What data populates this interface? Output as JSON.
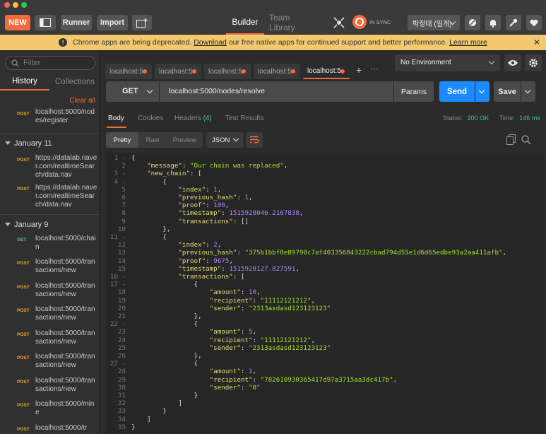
{
  "topbar": {
    "new_label": "NEW",
    "runner_label": "Runner",
    "import_label": "Import",
    "builder_tab": "Builder",
    "team_library_tab": "Team Library",
    "sync_label": "IN SYNC",
    "user_label": "박정태 (일개)"
  },
  "banner": {
    "text_before": "Chrome apps are being deprecated.",
    "download_link": "Download",
    "text_middle": "our free native apps for continued support and better performance.",
    "learn_more": "Learn more"
  },
  "sidebar": {
    "filter_placeholder": "Filter",
    "tab_history": "History",
    "tab_collections": "Collections",
    "clear_all": "Clear all",
    "top_item": {
      "method": "POST",
      "url": "localhost:5000/nodes/register"
    },
    "groups": [
      {
        "date": "January 11",
        "items": [
          {
            "method": "POST",
            "url": "https://datalab.naver.com/realtimeSearch/data.nav"
          },
          {
            "method": "POST",
            "url": "https://datalab.naver.com/realtimeSearch/data.nav"
          }
        ]
      },
      {
        "date": "January 9",
        "items": [
          {
            "method": "GET",
            "url": "localhost:5000/chain"
          },
          {
            "method": "POST",
            "url": "localhost:5000/transactions/new"
          },
          {
            "method": "POST",
            "url": "localhost:5000/transactions/new"
          },
          {
            "method": "POST",
            "url": "localhost:5000/transactions/new"
          },
          {
            "method": "POST",
            "url": "localhost:5000/transactions/new"
          },
          {
            "method": "POST",
            "url": "localhost:5000/transactions/new"
          },
          {
            "method": "POST",
            "url": "localhost:5000/transactions/new"
          },
          {
            "method": "POST",
            "url": "localhost:5000/mine"
          },
          {
            "method": "POST",
            "url": "localhost:5000/tr"
          }
        ]
      }
    ]
  },
  "tabs": [
    "localhost:5",
    "localhost:5",
    "localhost:5",
    "localhost:5",
    "localhost:5"
  ],
  "environment": "No Environment",
  "request": {
    "method": "GET",
    "url": "localhost:5000/nodes/resolve",
    "params_label": "Params",
    "send_label": "Send",
    "save_label": "Save"
  },
  "response_tabs": {
    "body": "Body",
    "cookies": "Cookies",
    "headers": "Headers",
    "headers_count": "(4)",
    "test_results": "Test Results",
    "status_label": "Status:",
    "status_value": "200 OK",
    "time_label": "Time:",
    "time_value": "146 ms"
  },
  "view_options": {
    "pretty": "Pretty",
    "raw": "Raw",
    "preview": "Preview",
    "format": "JSON"
  },
  "code_lines": [
    [
      [
        "p",
        "{"
      ]
    ],
    [
      [
        "p",
        "    "
      ],
      [
        "k",
        "\"message\""
      ],
      [
        "p",
        ": "
      ],
      [
        "s",
        "\"Our chain was replaced\""
      ],
      [
        "p",
        ","
      ]
    ],
    [
      [
        "p",
        "    "
      ],
      [
        "k",
        "\"new_chain\""
      ],
      [
        "p",
        ": ["
      ]
    ],
    [
      [
        "p",
        "        {"
      ]
    ],
    [
      [
        "p",
        "            "
      ],
      [
        "k",
        "\"index\""
      ],
      [
        "p",
        ": "
      ],
      [
        "n",
        "1"
      ],
      [
        "p",
        ","
      ]
    ],
    [
      [
        "p",
        "            "
      ],
      [
        "k",
        "\"previous_hash\""
      ],
      [
        "p",
        ": "
      ],
      [
        "n",
        "1"
      ],
      [
        "p",
        ","
      ]
    ],
    [
      [
        "p",
        "            "
      ],
      [
        "k",
        "\"proof\""
      ],
      [
        "p",
        ": "
      ],
      [
        "n",
        "100"
      ],
      [
        "p",
        ","
      ]
    ],
    [
      [
        "p",
        "            "
      ],
      [
        "k",
        "\"timestamp\""
      ],
      [
        "p",
        ": "
      ],
      [
        "n",
        "1515928046.2167838"
      ],
      [
        "p",
        ","
      ]
    ],
    [
      [
        "p",
        "            "
      ],
      [
        "k",
        "\"transactions\""
      ],
      [
        "p",
        ": []"
      ]
    ],
    [
      [
        "p",
        "        },"
      ]
    ],
    [
      [
        "p",
        "        {"
      ]
    ],
    [
      [
        "p",
        "            "
      ],
      [
        "k",
        "\"index\""
      ],
      [
        "p",
        ": "
      ],
      [
        "n",
        "2"
      ],
      [
        "p",
        ","
      ]
    ],
    [
      [
        "p",
        "            "
      ],
      [
        "k",
        "\"previous_hash\""
      ],
      [
        "p",
        ": "
      ],
      [
        "s",
        "\"375b1bbf0e89790c7af403356843222cbad794d55e1d6d65edbe93a2aa411afb\""
      ],
      [
        "p",
        ","
      ]
    ],
    [
      [
        "p",
        "            "
      ],
      [
        "k",
        "\"proof\""
      ],
      [
        "p",
        ": "
      ],
      [
        "n",
        "9675"
      ],
      [
        "p",
        ","
      ]
    ],
    [
      [
        "p",
        "            "
      ],
      [
        "k",
        "\"timestamp\""
      ],
      [
        "p",
        ": "
      ],
      [
        "n",
        "1515928127.827591"
      ],
      [
        "p",
        ","
      ]
    ],
    [
      [
        "p",
        "            "
      ],
      [
        "k",
        "\"transactions\""
      ],
      [
        "p",
        ": ["
      ]
    ],
    [
      [
        "p",
        "                {"
      ]
    ],
    [
      [
        "p",
        "                    "
      ],
      [
        "k",
        "\"amount\""
      ],
      [
        "p",
        ": "
      ],
      [
        "n",
        "10"
      ],
      [
        "p",
        ","
      ]
    ],
    [
      [
        "p",
        "                    "
      ],
      [
        "k",
        "\"recipient\""
      ],
      [
        "p",
        ": "
      ],
      [
        "s",
        "\"11112121212\""
      ],
      [
        "p",
        ","
      ]
    ],
    [
      [
        "p",
        "                    "
      ],
      [
        "k",
        "\"sender\""
      ],
      [
        "p",
        ": "
      ],
      [
        "s",
        "\"2313asdasd123123123\""
      ]
    ],
    [
      [
        "p",
        "                },"
      ]
    ],
    [
      [
        "p",
        "                {"
      ]
    ],
    [
      [
        "p",
        "                    "
      ],
      [
        "k",
        "\"amount\""
      ],
      [
        "p",
        ": "
      ],
      [
        "n",
        "5"
      ],
      [
        "p",
        ","
      ]
    ],
    [
      [
        "p",
        "                    "
      ],
      [
        "k",
        "\"recipient\""
      ],
      [
        "p",
        ": "
      ],
      [
        "s",
        "\"11112121212\""
      ],
      [
        "p",
        ","
      ]
    ],
    [
      [
        "p",
        "                    "
      ],
      [
        "k",
        "\"sender\""
      ],
      [
        "p",
        ": "
      ],
      [
        "s",
        "\"2313asdasd123123123\""
      ]
    ],
    [
      [
        "p",
        "                },"
      ]
    ],
    [
      [
        "p",
        "                {"
      ]
    ],
    [
      [
        "p",
        "                    "
      ],
      [
        "k",
        "\"amount\""
      ],
      [
        "p",
        ": "
      ],
      [
        "n",
        "1"
      ],
      [
        "p",
        ","
      ]
    ],
    [
      [
        "p",
        "                    "
      ],
      [
        "k",
        "\"recipient\""
      ],
      [
        "p",
        ": "
      ],
      [
        "s",
        "\"782610930365417d97a3715aa3dc417b\""
      ],
      [
        "p",
        ","
      ]
    ],
    [
      [
        "p",
        "                    "
      ],
      [
        "k",
        "\"sender\""
      ],
      [
        "p",
        ": "
      ],
      [
        "s",
        "\"0\""
      ]
    ],
    [
      [
        "p",
        "                }"
      ]
    ],
    [
      [
        "p",
        "            ]"
      ]
    ],
    [
      [
        "p",
        "        }"
      ]
    ],
    [
      [
        "p",
        "    ]"
      ]
    ],
    [
      [
        "p",
        "}"
      ]
    ]
  ],
  "foldable_lines": [
    1,
    3,
    4,
    11,
    16,
    17,
    22,
    27
  ],
  "colors": {
    "accent_orange": "#f26b3a",
    "send_blue": "#1a8cff",
    "status_green": "#4cc38a",
    "banner_yellow": "#f3c86e"
  }
}
